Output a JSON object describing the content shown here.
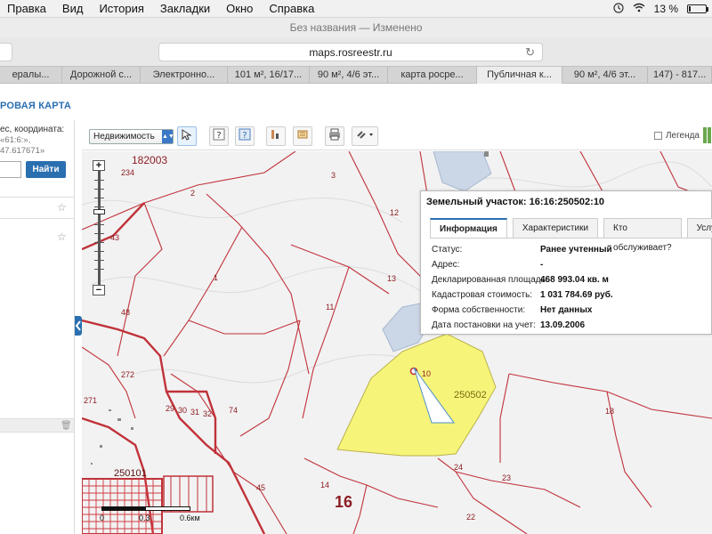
{
  "macmenu": {
    "items": [
      "Правка",
      "Вид",
      "История",
      "Закладки",
      "Окно",
      "Справка"
    ],
    "battery": "13 %"
  },
  "window": {
    "title": "Без названия — Изменено"
  },
  "browser": {
    "url": "maps.rosreestr.ru",
    "tabs": [
      "ералы...",
      "Дорожной с...",
      "Электронно...",
      "101 м², 16/17...",
      "90 м², 4/6 эт...",
      "карта росре...",
      "Публичная к...",
      "90 м², 4/6 эт...",
      "147) - 817..."
    ],
    "active_tab_index": 6
  },
  "app": {
    "title_fragment": "РОВАЯ КАРТА",
    "search_hint": "ес, координата:",
    "example_1": "«61:6:»,",
    "example_2": "47.617671»",
    "find_button": "Найти"
  },
  "map_toolbar": {
    "layer_select_value": "Недвижимость",
    "legend_label": "Легенда"
  },
  "map": {
    "labels": {
      "block_182003": "182003",
      "n234": "234",
      "n3": "3",
      "n2": "2",
      "n12": "12",
      "n43": "43",
      "n1": "1",
      "n11": "11",
      "n13": "13",
      "n48": "48",
      "n272": "272",
      "n74": "74",
      "n29": "29",
      "n30": "30",
      "n31": "31",
      "n32": "32",
      "n271": "271",
      "block_250101": "250101",
      "n45": "45",
      "n14": "14",
      "n16": "16",
      "n24": "24",
      "n23": "23",
      "n22": "22",
      "n10": "10",
      "block_250502": "250502",
      "n18": "18"
    },
    "scale": {
      "zero": "0",
      "mid": "0.3",
      "end": "0.6км"
    }
  },
  "popup": {
    "title": "Земельный участок: 16:16:250502:10",
    "tabs": [
      "Информация",
      "Характеристики",
      "Кто обслуживает?",
      "Услу"
    ],
    "rows": [
      {
        "label": "Статус:",
        "value": "Ранее учтенный"
      },
      {
        "label": "Адрес:",
        "value": "-"
      },
      {
        "label": "Декларированная площадь:",
        "value": "468 993.04 кв. м"
      },
      {
        "label": "Кадастровая стоимость:",
        "value": "1 031 784.69 руб."
      },
      {
        "label": "Форма собственности:",
        "value": "Нет данных"
      },
      {
        "label": "Дата постановки на учет:",
        "value": "13.09.2006"
      }
    ]
  },
  "colors": {
    "accent": "#2a6fb0",
    "parcel_border": "#c0323a",
    "highlight_fill": "#f7f47a",
    "water": "#cbd6e6"
  },
  "battery_level": 0.13,
  "icons": {
    "history": "clock-icon",
    "wifi": "wifi-icon",
    "reload": "reload-icon",
    "search": "search-icon",
    "star": "star-icon"
  }
}
